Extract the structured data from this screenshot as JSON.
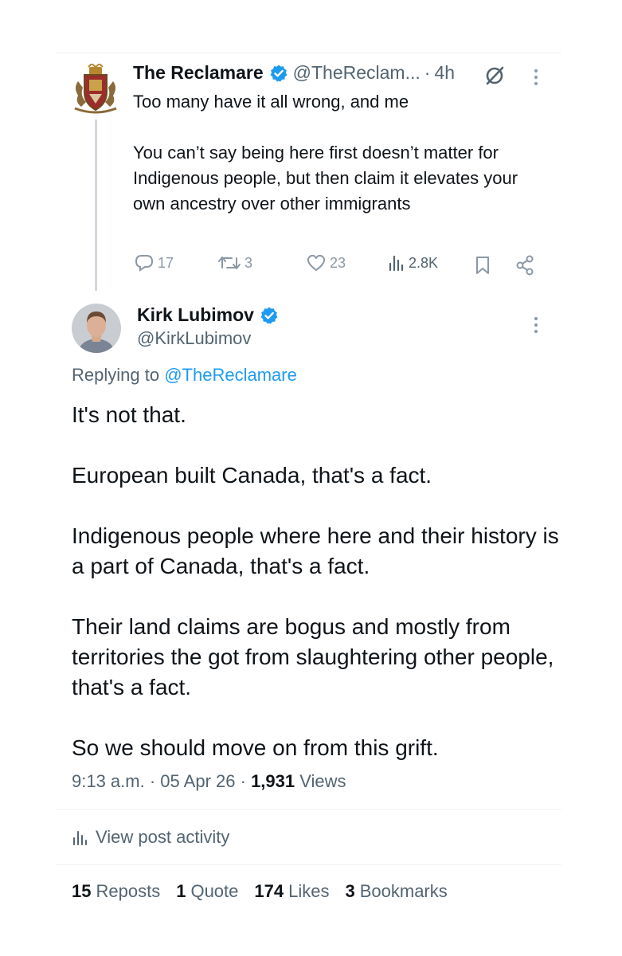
{
  "parent_tweet": {
    "display_name": "The Reclamare",
    "handle": "@TheReclam...",
    "separator": "·",
    "time": "4h",
    "text": "Too many have it all wrong, and me\n\nYou can’t say being here first doesn’t matter for Indigenous people, but then claim it elevates your own ancestry over other immigrants",
    "replies": "17",
    "reposts": "3",
    "likes": "23",
    "views": "2.8K",
    "icons": [
      "verified-badge-icon",
      "grok-icon",
      "more-icon",
      "reply-icon",
      "repost-icon",
      "like-icon",
      "views-icon",
      "bookmark-icon",
      "share-icon"
    ]
  },
  "reply_tweet": {
    "display_name": "Kirk Lubimov",
    "handle": "@KirkLubimov",
    "replying_label": "Replying to",
    "replying_to": "@TheReclamare",
    "text": "It's not that.\n\nEuropean built Canada, that's a fact.\n\nIndigenous people where here and their history is a part of Canada, that's a fact.\n\nTheir land claims are bogus and mostly from territories the got from slaughtering other people, that's a fact.\n\nSo we should move on from this grift.",
    "time": "9:13 a.m.",
    "date": "05 Apr 26",
    "separator": "·",
    "views_count": "1,931",
    "views_label": "Views",
    "activity_label": "View post activity",
    "stats": {
      "reposts_count": "15",
      "reposts_label": "Reposts",
      "quotes_count": "1",
      "quotes_label": "Quote",
      "likes_count": "174",
      "likes_label": "Likes",
      "bookmarks_count": "3",
      "bookmarks_label": "Bookmarks"
    }
  },
  "colors": {
    "text": "#0f1419",
    "muted": "#536471",
    "link": "#1d9bf0",
    "verified": "#1d9bf0",
    "divider": "#eff3f4",
    "thread_line": "#cfd9de"
  }
}
